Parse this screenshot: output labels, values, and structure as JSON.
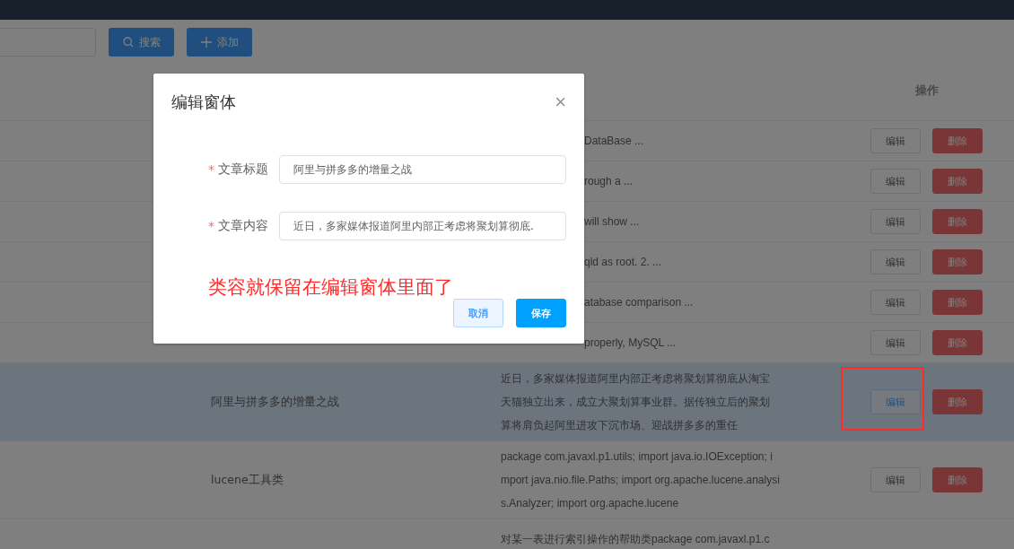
{
  "toolbar": {
    "search_button": "搜索",
    "add_button": "添加"
  },
  "table": {
    "columns": [
      {
        "label": "操作"
      }
    ],
    "rows": [
      {
        "content": "DataBase ...",
        "highlighted": false,
        "annotated": false,
        "edit_label": "编辑",
        "delete_label": "删除"
      },
      {
        "content": "rough a ...",
        "highlighted": false,
        "annotated": false,
        "edit_label": "编辑",
        "delete_label": "删除"
      },
      {
        "content": "will show ...",
        "highlighted": false,
        "annotated": false,
        "edit_label": "编辑",
        "delete_label": "删除"
      },
      {
        "content": "qld as root. 2. ...",
        "highlighted": false,
        "annotated": false,
        "edit_label": "编辑",
        "delete_label": "删除"
      },
      {
        "content": "atabase comparison ...",
        "highlighted": false,
        "annotated": false,
        "edit_label": "编辑",
        "delete_label": "删除"
      },
      {
        "content": "properly, MySQL ...",
        "highlighted": false,
        "annotated": false,
        "edit_label": "编辑",
        "delete_label": "删除"
      },
      {
        "title": "阿里与拼多多的增量之战",
        "content": "近日，多家媒体报道阿里内部正考虑将聚划算彻底从淘宝天猫独立出来，成立大聚划算事业群。据传独立后的聚划算将肩负起阿里进攻下沉市场、迎战拼多多的重任",
        "highlighted": true,
        "annotated": true,
        "edit_hovered": true,
        "edit_label": "编辑",
        "delete_label": "删除"
      },
      {
        "title": "lucene工具类",
        "content": "package com.javaxl.p1.utils; import java.io.IOException; import java.nio.file.Paths; import org.apache.lucene.analysis.Analyzer; import org.apache.lucene",
        "highlighted": false,
        "annotated": false,
        "edit_label": "编辑",
        "delete_label": "删除"
      },
      {
        "content": "对某一表进行索引操作的帮助类package com.javaxl.p1.c",
        "highlighted": false,
        "annotated": false
      }
    ]
  },
  "dialog": {
    "title": "编辑窗体",
    "close": "×",
    "fields": [
      {
        "label": "文章标题",
        "mark": "*",
        "value": "阿里与拼多多的增量之战"
      },
      {
        "label": "文章内容",
        "mark": "*",
        "value": "近日，多家媒体报道阿里内部正考虑将聚划算彻底."
      }
    ],
    "annotation": "类容就保留在编辑窗体里面了",
    "buttons": [
      {
        "label": "取消",
        "kind": "plain"
      },
      {
        "label": "保存",
        "kind": "primary"
      }
    ]
  }
}
